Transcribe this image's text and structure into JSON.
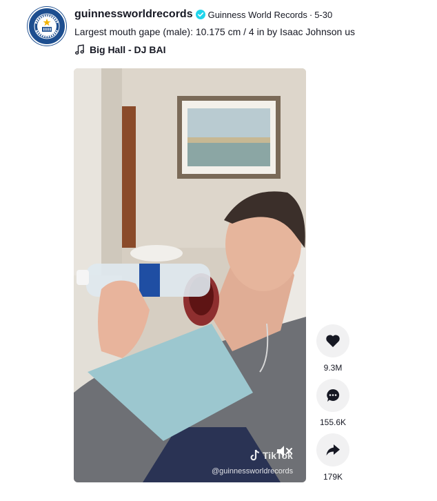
{
  "post": {
    "username": "guinnessworldrecords",
    "nickname": "Guinness World Records",
    "separator": "·",
    "date": "5-30",
    "caption": "Largest mouth gape (male): 10.175 cm / 4 in by Isaac Johnson us",
    "music": "Big Hall - DJ BAI"
  },
  "avatar": {
    "top_text": "GUINNESS",
    "bottom_text": "WORLD RECORDS"
  },
  "video": {
    "watermark_brand": "TikTok",
    "watermark_handle": "@guinnessworldrecords"
  },
  "actions": {
    "likes": "9.3M",
    "comments": "155.6K",
    "shares": "179K"
  },
  "colors": {
    "verified": "#20d5ec",
    "avatar_bg": "#1d4e8f",
    "action_bg": "#f1f1f2"
  }
}
